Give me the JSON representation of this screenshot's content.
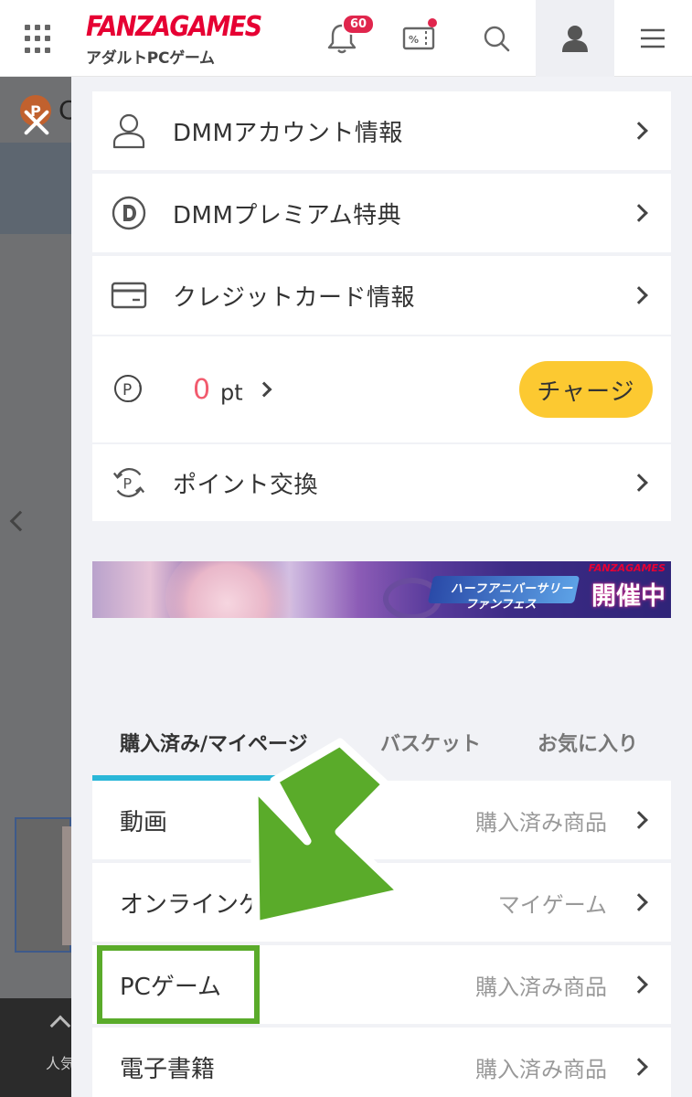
{
  "header": {
    "logo_main": "FANZAGAMES",
    "logo_sub": "アダルトPCゲーム",
    "notification_count": "60"
  },
  "background_page": {
    "point_coin": "P",
    "partial_letter": "C",
    "bottom_label": "人気"
  },
  "drawer": {
    "account_items": [
      {
        "label": "DMMアカウント情報",
        "icon": "person-icon"
      },
      {
        "label": "DMMプレミアム特典",
        "icon": "dmm-premium-icon"
      },
      {
        "label": "クレジットカード情報",
        "icon": "credit-card-icon"
      }
    ],
    "points": {
      "value": "0",
      "unit": "pt",
      "charge_label": "チャージ"
    },
    "point_exchange_label": "ポイント交換",
    "banner": {
      "ribbon_line1": "ハーフアニバーサリー",
      "ribbon_line2": "ファンフェス",
      "logo": "FANZAGAMES",
      "status": "開催中"
    },
    "tabs": [
      {
        "label": "購入済み/マイページ",
        "active": true
      },
      {
        "label": "バスケット",
        "active": false
      },
      {
        "label": "お気に入り",
        "active": false
      }
    ],
    "categories": [
      {
        "label": "動画",
        "sub": "購入済み商品"
      },
      {
        "label": "オンラインゲーム",
        "sub": "マイゲーム"
      },
      {
        "label": "PCゲーム",
        "sub": "購入済み商品"
      },
      {
        "label": "電子書籍",
        "sub": "購入済み商品"
      }
    ]
  },
  "colors": {
    "brand": "#e60033",
    "points_value": "#f25b6e",
    "charge_button": "#fcc931",
    "tab_active_underline": "#2ab7d8",
    "annotation_green": "#5aab2a"
  }
}
